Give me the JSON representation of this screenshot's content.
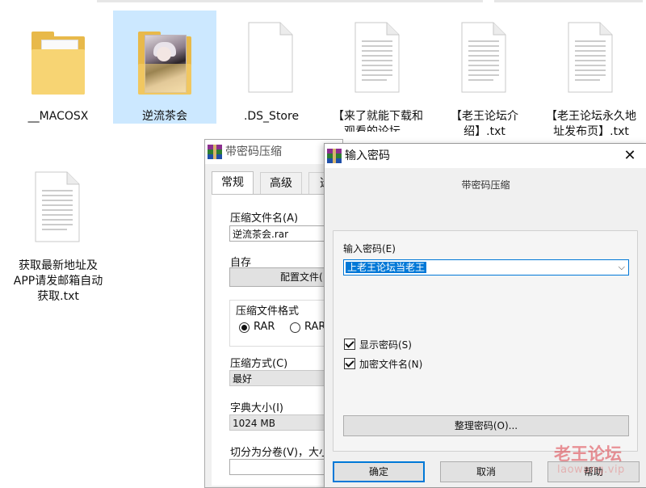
{
  "desktop": {
    "items": [
      {
        "label": "__MACOSX",
        "type": "folder"
      },
      {
        "label": "逆流茶会",
        "type": "folder-with-picture",
        "selected": true
      },
      {
        "label": ".DS_Store",
        "type": "blank-file"
      },
      {
        "label": "【来了就能下载和观看的论坛，",
        "type": "text-file"
      },
      {
        "label": "【老王论坛介绍】.txt",
        "type": "text-file"
      },
      {
        "label": "【老王论坛永久地址发布页】.txt",
        "type": "text-file"
      },
      {
        "label": "获取最新地址及APP请发邮箱自动获取.txt",
        "type": "text-file"
      }
    ]
  },
  "archive_dialog": {
    "title": "带密码压缩",
    "tabs": [
      "常规",
      "高级",
      "选"
    ],
    "archive_name_label": "压缩文件名(A)",
    "archive_name_value": "逆流茶会.rar",
    "profile_label": "自存",
    "profile_button": "配置文件(",
    "format_group_label": "压缩文件格式",
    "format_rar": "RAR",
    "format_rar5": "RAR",
    "method_label": "压缩方式(C)",
    "method_value": "最好",
    "dict_label": "字典大小(I)",
    "dict_value": "1024 MB",
    "split_label": "切分为分卷(V)，大小"
  },
  "password_dialog": {
    "title": "输入密码",
    "subtitle": "带密码压缩",
    "password_label": "输入密码(E)",
    "password_value": "上老王论坛当老王",
    "show_password_label": "显示密码(S)",
    "show_password_checked": true,
    "encrypt_names_label": "加密文件名(N)",
    "encrypt_names_checked": true,
    "organize_button": "整理密码(O)...",
    "ok_button": "确定",
    "cancel_button": "取消",
    "help_button": "帮助",
    "close_glyph": "✕",
    "caret_glyph": "⌵"
  },
  "watermark": {
    "line1": "老王论坛",
    "line2": "laowang.vip"
  },
  "colors": {
    "selection": "#cce8ff",
    "accent": "#0078d7",
    "dialog_bg": "#f0f0f0",
    "folder_yellow": "#f7d473"
  }
}
